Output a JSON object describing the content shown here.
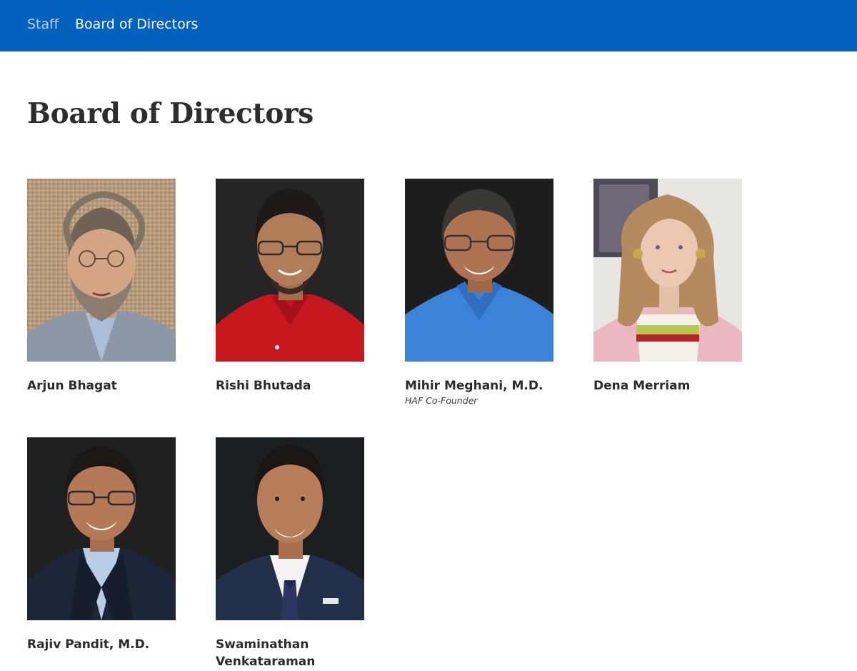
{
  "nav": {
    "items": [
      {
        "label": "Staff"
      },
      {
        "label": "Board of Directors"
      }
    ]
  },
  "page": {
    "title": "Board of Directors"
  },
  "directors": [
    {
      "name": "Arjun Bhagat",
      "role": ""
    },
    {
      "name": "Rishi Bhutada",
      "role": ""
    },
    {
      "name": "Mihir Meghani, M.D.",
      "role": "HAF Co-Founder"
    },
    {
      "name": "Dena Merriam",
      "role": ""
    },
    {
      "name": "Rajiv Pandit, M.D.",
      "role": ""
    },
    {
      "name": "Swaminathan Venkataraman",
      "role": ""
    }
  ],
  "colors": {
    "nav_background": "#0461bd",
    "nav_active": "#ffffff",
    "nav_inactive": "#b8d0ef",
    "heading": "#2d2d2d"
  }
}
